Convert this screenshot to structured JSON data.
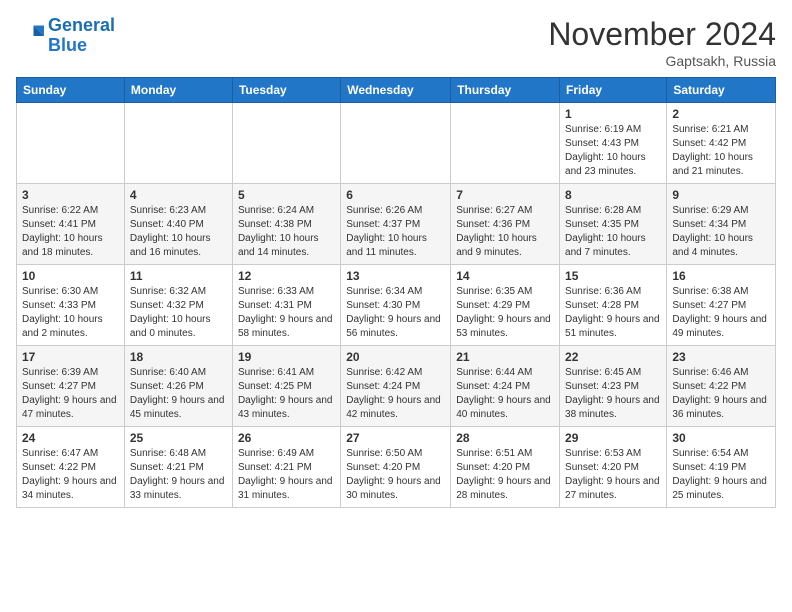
{
  "header": {
    "logo_line1": "General",
    "logo_line2": "Blue",
    "month": "November 2024",
    "location": "Gaptsakh, Russia"
  },
  "weekdays": [
    "Sunday",
    "Monday",
    "Tuesday",
    "Wednesday",
    "Thursday",
    "Friday",
    "Saturday"
  ],
  "weeks": [
    [
      {
        "day": "",
        "info": ""
      },
      {
        "day": "",
        "info": ""
      },
      {
        "day": "",
        "info": ""
      },
      {
        "day": "",
        "info": ""
      },
      {
        "day": "",
        "info": ""
      },
      {
        "day": "1",
        "info": "Sunrise: 6:19 AM\nSunset: 4:43 PM\nDaylight: 10 hours and 23 minutes."
      },
      {
        "day": "2",
        "info": "Sunrise: 6:21 AM\nSunset: 4:42 PM\nDaylight: 10 hours and 21 minutes."
      }
    ],
    [
      {
        "day": "3",
        "info": "Sunrise: 6:22 AM\nSunset: 4:41 PM\nDaylight: 10 hours and 18 minutes."
      },
      {
        "day": "4",
        "info": "Sunrise: 6:23 AM\nSunset: 4:40 PM\nDaylight: 10 hours and 16 minutes."
      },
      {
        "day": "5",
        "info": "Sunrise: 6:24 AM\nSunset: 4:38 PM\nDaylight: 10 hours and 14 minutes."
      },
      {
        "day": "6",
        "info": "Sunrise: 6:26 AM\nSunset: 4:37 PM\nDaylight: 10 hours and 11 minutes."
      },
      {
        "day": "7",
        "info": "Sunrise: 6:27 AM\nSunset: 4:36 PM\nDaylight: 10 hours and 9 minutes."
      },
      {
        "day": "8",
        "info": "Sunrise: 6:28 AM\nSunset: 4:35 PM\nDaylight: 10 hours and 7 minutes."
      },
      {
        "day": "9",
        "info": "Sunrise: 6:29 AM\nSunset: 4:34 PM\nDaylight: 10 hours and 4 minutes."
      }
    ],
    [
      {
        "day": "10",
        "info": "Sunrise: 6:30 AM\nSunset: 4:33 PM\nDaylight: 10 hours and 2 minutes."
      },
      {
        "day": "11",
        "info": "Sunrise: 6:32 AM\nSunset: 4:32 PM\nDaylight: 10 hours and 0 minutes."
      },
      {
        "day": "12",
        "info": "Sunrise: 6:33 AM\nSunset: 4:31 PM\nDaylight: 9 hours and 58 minutes."
      },
      {
        "day": "13",
        "info": "Sunrise: 6:34 AM\nSunset: 4:30 PM\nDaylight: 9 hours and 56 minutes."
      },
      {
        "day": "14",
        "info": "Sunrise: 6:35 AM\nSunset: 4:29 PM\nDaylight: 9 hours and 53 minutes."
      },
      {
        "day": "15",
        "info": "Sunrise: 6:36 AM\nSunset: 4:28 PM\nDaylight: 9 hours and 51 minutes."
      },
      {
        "day": "16",
        "info": "Sunrise: 6:38 AM\nSunset: 4:27 PM\nDaylight: 9 hours and 49 minutes."
      }
    ],
    [
      {
        "day": "17",
        "info": "Sunrise: 6:39 AM\nSunset: 4:27 PM\nDaylight: 9 hours and 47 minutes."
      },
      {
        "day": "18",
        "info": "Sunrise: 6:40 AM\nSunset: 4:26 PM\nDaylight: 9 hours and 45 minutes."
      },
      {
        "day": "19",
        "info": "Sunrise: 6:41 AM\nSunset: 4:25 PM\nDaylight: 9 hours and 43 minutes."
      },
      {
        "day": "20",
        "info": "Sunrise: 6:42 AM\nSunset: 4:24 PM\nDaylight: 9 hours and 42 minutes."
      },
      {
        "day": "21",
        "info": "Sunrise: 6:44 AM\nSunset: 4:24 PM\nDaylight: 9 hours and 40 minutes."
      },
      {
        "day": "22",
        "info": "Sunrise: 6:45 AM\nSunset: 4:23 PM\nDaylight: 9 hours and 38 minutes."
      },
      {
        "day": "23",
        "info": "Sunrise: 6:46 AM\nSunset: 4:22 PM\nDaylight: 9 hours and 36 minutes."
      }
    ],
    [
      {
        "day": "24",
        "info": "Sunrise: 6:47 AM\nSunset: 4:22 PM\nDaylight: 9 hours and 34 minutes."
      },
      {
        "day": "25",
        "info": "Sunrise: 6:48 AM\nSunset: 4:21 PM\nDaylight: 9 hours and 33 minutes."
      },
      {
        "day": "26",
        "info": "Sunrise: 6:49 AM\nSunset: 4:21 PM\nDaylight: 9 hours and 31 minutes."
      },
      {
        "day": "27",
        "info": "Sunrise: 6:50 AM\nSunset: 4:20 PM\nDaylight: 9 hours and 30 minutes."
      },
      {
        "day": "28",
        "info": "Sunrise: 6:51 AM\nSunset: 4:20 PM\nDaylight: 9 hours and 28 minutes."
      },
      {
        "day": "29",
        "info": "Sunrise: 6:53 AM\nSunset: 4:20 PM\nDaylight: 9 hours and 27 minutes."
      },
      {
        "day": "30",
        "info": "Sunrise: 6:54 AM\nSunset: 4:19 PM\nDaylight: 9 hours and 25 minutes."
      }
    ]
  ]
}
